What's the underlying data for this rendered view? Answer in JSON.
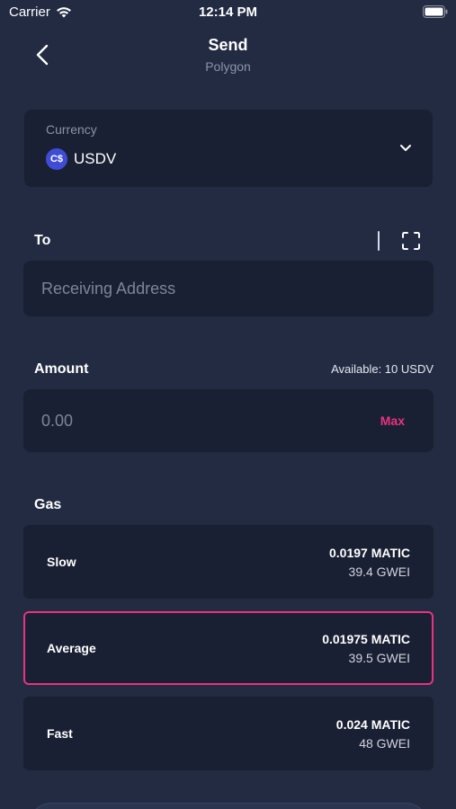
{
  "status_bar": {
    "carrier": "Carrier",
    "time": "12:14 PM"
  },
  "header": {
    "title": "Send",
    "subtitle": "Polygon"
  },
  "currency": {
    "label": "Currency",
    "icon_text": "C$",
    "value": "USDV"
  },
  "to": {
    "label": "To",
    "placeholder": "Receiving Address"
  },
  "amount": {
    "label": "Amount",
    "available": "Available: 10 USDV",
    "placeholder": "0.00",
    "max_label": "Max"
  },
  "gas": {
    "label": "Gas",
    "options": [
      {
        "name": "Slow",
        "matic": "0.0197 MATIC",
        "gwei": "39.4 GWEI",
        "selected": false
      },
      {
        "name": "Average",
        "matic": "0.01975 MATIC",
        "gwei": "39.5 GWEI",
        "selected": true
      },
      {
        "name": "Fast",
        "matic": "0.024 MATIC",
        "gwei": "48 GWEI",
        "selected": false
      }
    ]
  },
  "colors": {
    "background": "#222b42",
    "card": "#1a2033",
    "accent": "#e8337f",
    "coin": "#3f4dd6"
  }
}
